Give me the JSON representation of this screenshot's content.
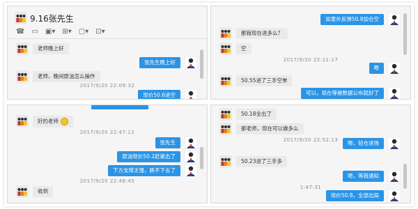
{
  "header": {
    "title": "9.16张先生",
    "tools": [
      "phone-icon",
      "video-icon",
      "screen-share-icon",
      "file-transfer-icon",
      "remote-icon",
      "more-icon"
    ]
  },
  "panel1": {
    "messages": [
      {
        "dir": "in",
        "text": "老师晚上好"
      },
      {
        "dir": "out",
        "text": "张先生晚上好"
      },
      {
        "dir": "in",
        "text": "老师，晚间原油怎么操作"
      },
      {
        "dir": "out",
        "text": "现价50.6进空"
      }
    ],
    "timestamp": "2017/9/20  22:09:32"
  },
  "panel2": {
    "messages": [
      {
        "dir": "out",
        "text": "如意外反弹50.8加仓空"
      },
      {
        "dir": "in",
        "text": "那我现在进多么？"
      },
      {
        "dir": "in",
        "text": "空"
      },
      {
        "dir": "out",
        "text": "嗯"
      },
      {
        "dir": "in",
        "text": "50.55进了三手空单"
      },
      {
        "dir": "out",
        "text": "可以，现在等被数据公布就好了"
      }
    ],
    "timestamp": "2017/9/20  22:11:17"
  },
  "panel3": {
    "messages": [
      {
        "dir": "in",
        "text": "好的老师"
      },
      {
        "dir": "out",
        "text": "张先生"
      },
      {
        "dir": "out",
        "text": "原油现价50.2赶紧出了"
      },
      {
        "dir": "out",
        "text": "下方支撑太强，跌不下去了"
      },
      {
        "dir": "in",
        "text": "收到"
      }
    ],
    "timestamp1": "2017/9/20  22:47:12",
    "timestamp2": "2017/9/20  22:48:45"
  },
  "panel4": {
    "messages": [
      {
        "dir": "in",
        "text": "50.18全出了"
      },
      {
        "dir": "in",
        "text": "那老师，现在可以做多么"
      },
      {
        "dir": "out",
        "text": "嗯，轻仓进场"
      },
      {
        "dir": "in",
        "text": "50.23进了三手多"
      },
      {
        "dir": "out",
        "text": "嗯，等我通知"
      },
      {
        "dir": "out",
        "text": "现价50.8，全部出局"
      }
    ],
    "timestamp1": "2017/9/20  22:52:13",
    "timestamp2": "1:47:31"
  },
  "colors": {
    "bubble_out": "#2a94e6",
    "bubble_in": "#eaeaea",
    "panel_bg": "#f5f5f5"
  }
}
